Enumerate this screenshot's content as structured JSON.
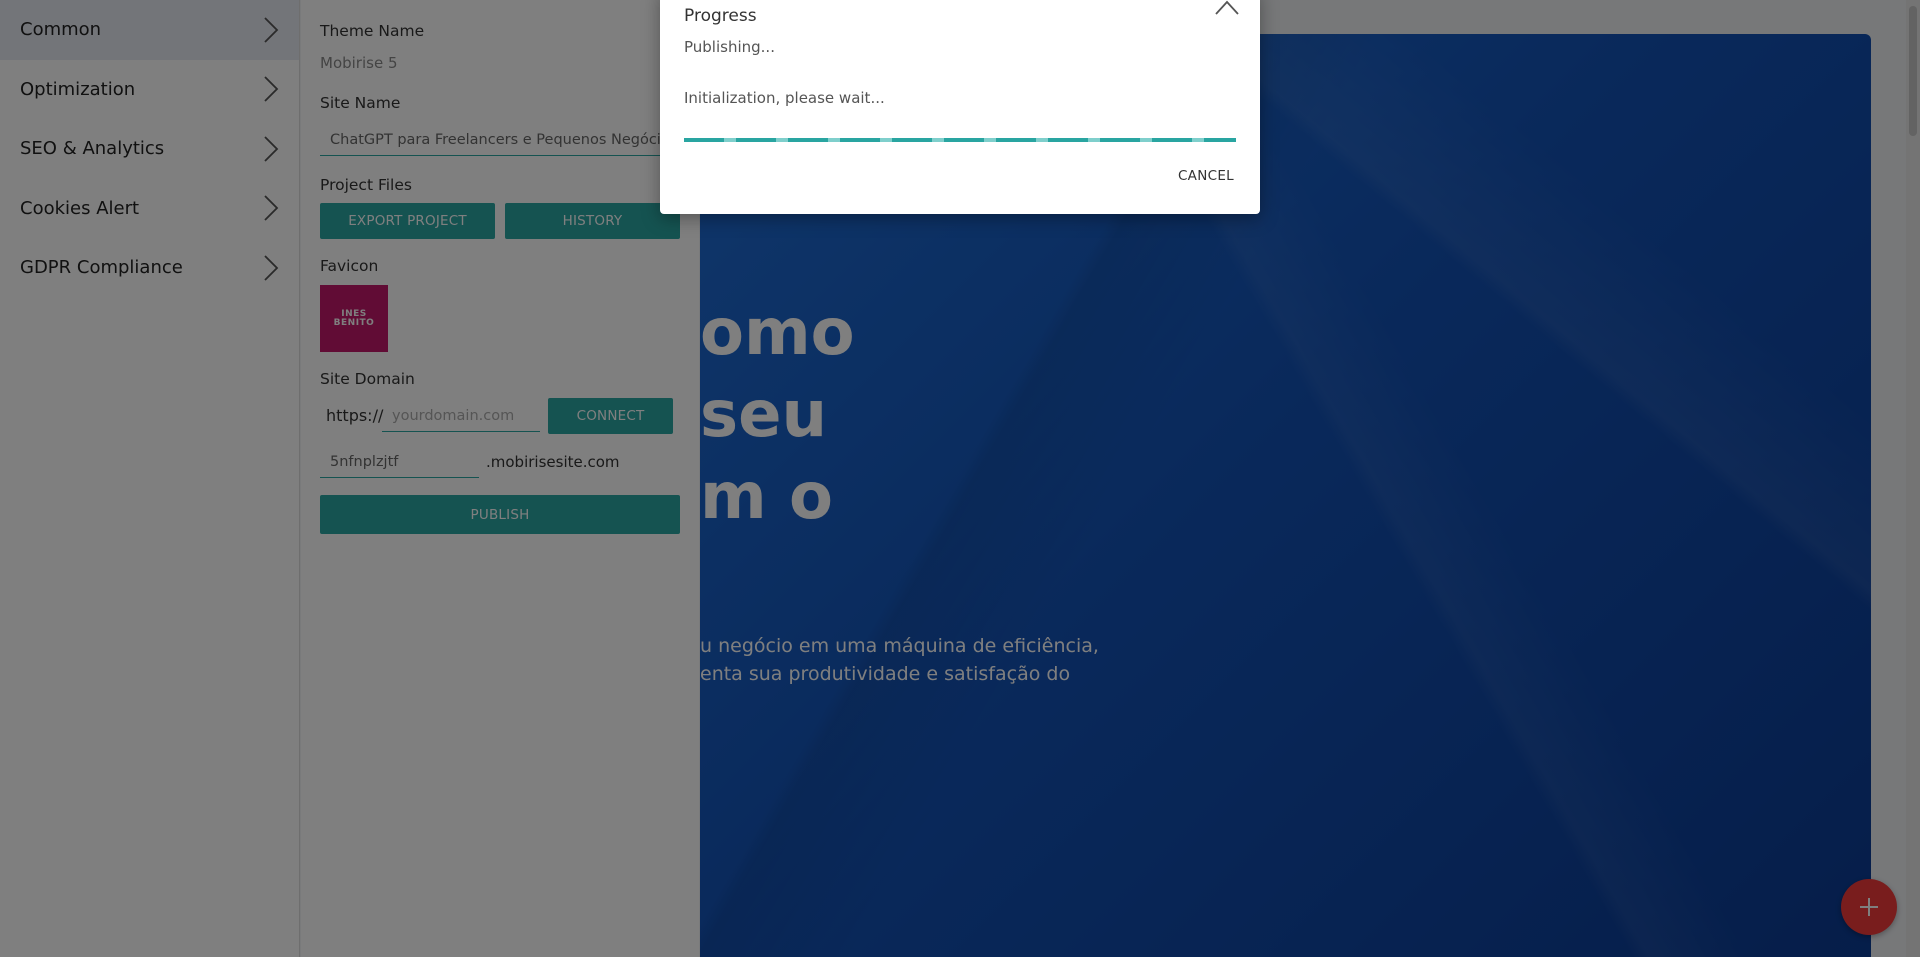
{
  "menu": {
    "items": [
      {
        "label": "Common",
        "active": true
      },
      {
        "label": "Optimization"
      },
      {
        "label": "SEO & Analytics"
      },
      {
        "label": "Cookies Alert"
      },
      {
        "label": "GDPR Compliance"
      }
    ]
  },
  "settings": {
    "theme_name_label": "Theme Name",
    "theme_name_value": "Mobirise 5",
    "site_name_label": "Site Name",
    "site_name_value": "ChatGPT para Freelancers e Pequenos Negócios",
    "project_files_label": "Project Files",
    "export_button": "EXPORT PROJECT",
    "history_button": "HISTORY",
    "favicon_label": "Favicon",
    "favicon_text_1": "INES",
    "favicon_text_2": "BENITO",
    "site_domain_label": "Site Domain",
    "domain_prefix": "https://",
    "domain_placeholder": "yourdomain.com",
    "connect_button": "CONNECT",
    "subdomain_value": "5nfnplzjtf",
    "subdomain_suffix": ".mobirisesite.com",
    "publish_button": "PUBLISH"
  },
  "preview": {
    "title_lines": [
      "omo",
      "seu",
      "m o"
    ],
    "subtitle_lines": [
      "u negócio em uma máquina de eficiência,",
      "enta sua produtividade e satisfação do"
    ]
  },
  "dialog": {
    "title": "Progress",
    "status": "Publishing...",
    "message": "Initialization, please wait...",
    "progress": 1.0,
    "cancel_label": "CANCEL"
  },
  "colors": {
    "accent": "#2aa6a2",
    "fab": "#f23b3b",
    "hero": "#1352b6"
  },
  "icons": {
    "menu_chevron": "chevron-right-icon",
    "dialog_close": "chevron-up-icon",
    "fab": "plus-icon"
  }
}
